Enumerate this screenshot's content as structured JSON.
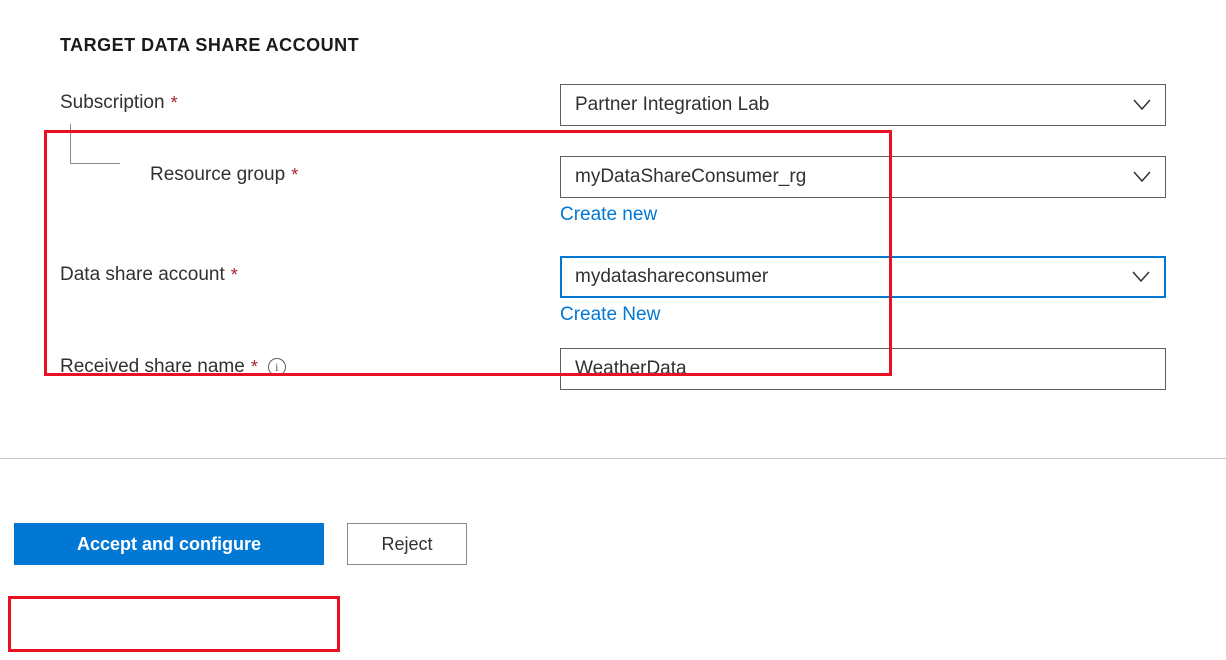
{
  "section": {
    "title": "TARGET DATA SHARE ACCOUNT"
  },
  "fields": {
    "subscription": {
      "label": "Subscription",
      "value": "Partner Integration Lab"
    },
    "resourceGroup": {
      "label": "Resource group",
      "value": "myDataShareConsumer_rg",
      "createLink": "Create new"
    },
    "dataShareAccount": {
      "label": "Data share account",
      "value": "mydatashareconsumer",
      "createLink": "Create New"
    },
    "receivedShareName": {
      "label": "Received share name",
      "value": "WeatherData"
    }
  },
  "buttons": {
    "accept": "Accept and configure",
    "reject": "Reject"
  }
}
